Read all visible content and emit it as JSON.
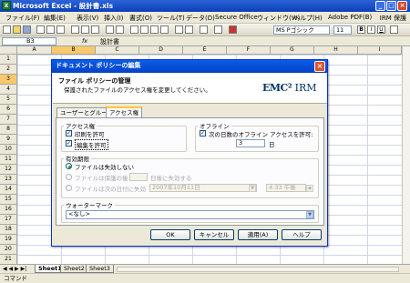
{
  "window": {
    "title": "Microsoft Excel - 設計書.xls",
    "irm_menu": "IRM 保護"
  },
  "menu": [
    "ファイル(F)",
    "編集(E)",
    "表示(V)",
    "挿入(I)",
    "書式(O)",
    "ツール(T)",
    "データ(D)",
    "Secure Office",
    "ウィンドウ(W)",
    "ヘルプ(H)",
    "Adobe PDF(B)"
  ],
  "toolbar": {
    "font_name": "MS Pゴシック",
    "font_size": "11"
  },
  "formula": {
    "cell_ref": "B3",
    "fx": "fx",
    "value": "設計書"
  },
  "grid": {
    "columns": [
      "A",
      "B",
      "C",
      "D",
      "E",
      "F",
      "G",
      "H",
      "I"
    ],
    "selected_column": "B",
    "rows": [
      "1",
      "2",
      "3",
      "4",
      "5",
      "6",
      "7",
      "8",
      "9",
      "10",
      "11",
      "12",
      "13",
      "14",
      "15",
      "16",
      "17",
      "18",
      "19",
      "20",
      "21"
    ],
    "selected_row": "3"
  },
  "sheets": [
    "Sheet1",
    "Sheet2",
    "Sheet3"
  ],
  "active_sheet": "Sheet1",
  "tab_nav": "◀ ◀ ▶ ▶|",
  "status": "コマンド",
  "dialog": {
    "title": "ドキュメント ポリシーの編集",
    "banner_title": "ファイル ポリシーの管理",
    "banner_sub": "保護されたファイルのアクセス権を変更してください。",
    "logo_emc": "EMC²",
    "logo_irm": "IRM",
    "tabs": [
      "ユーザーとグループ",
      "アクセス権"
    ],
    "active_tab": "アクセス権",
    "access": {
      "label": "アクセス権",
      "print": {
        "label": "印刷を許可",
        "checked": true
      },
      "edit": {
        "label": "編集を許可",
        "checked": true
      }
    },
    "offline": {
      "label": "オフライン",
      "allow_label": "次の日数のオフライン アクセスを許可:",
      "checked": true,
      "days": "3",
      "days_unit": "日"
    },
    "expiry": {
      "label": "有効期限",
      "never": "ファイルは失効しない",
      "after_days_prefix": "ファイルは保護の後",
      "after_days_suffix": "日後に失効する",
      "on_date": "ファイルは次の日付に失効",
      "date_value": "2007年10月11日",
      "time_value": "4:33 午後",
      "selected": "never"
    },
    "watermark": {
      "label": "ウォーターマーク",
      "value": "<なし>"
    },
    "buttons": {
      "ok": "OK",
      "cancel": "キャンセル",
      "apply": "適用(A)",
      "help": "ヘルプ"
    }
  }
}
